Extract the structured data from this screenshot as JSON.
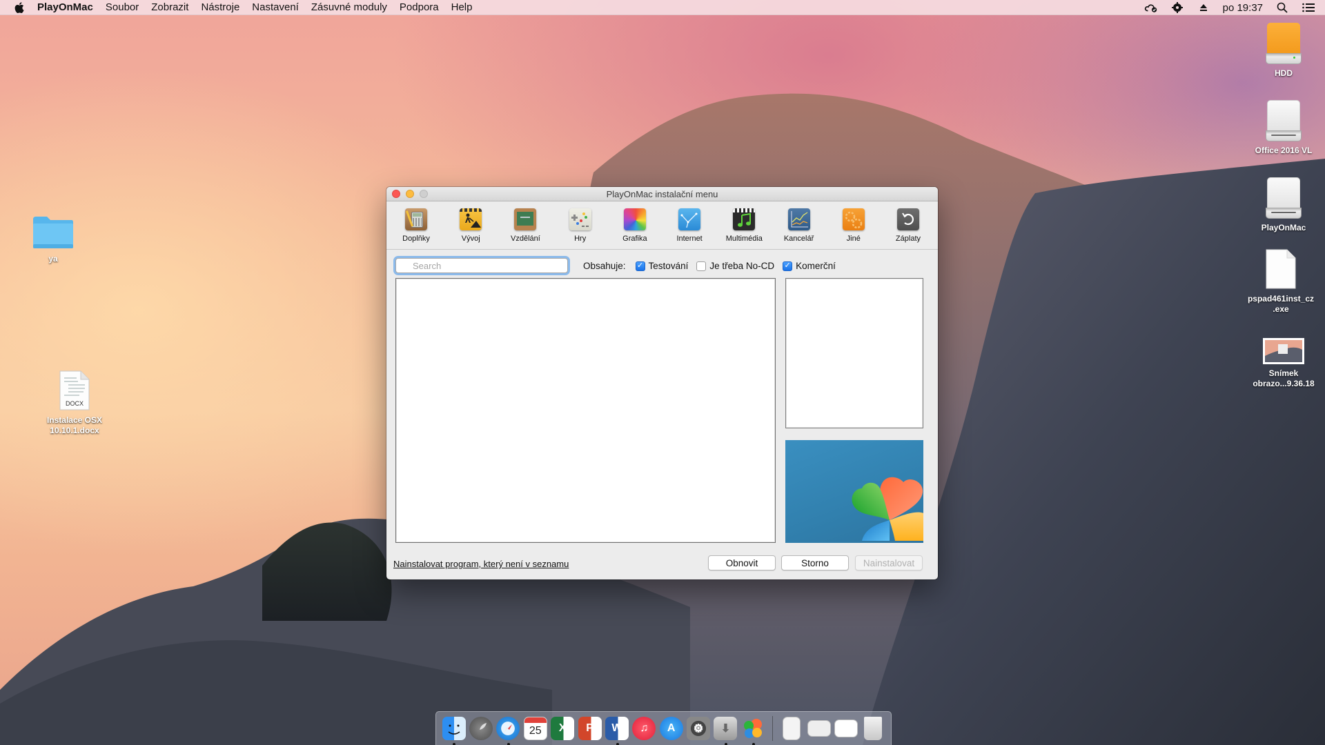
{
  "menubar": {
    "app_name": "PlayOnMac",
    "items": [
      "Soubor",
      "Zobrazit",
      "Nástroje",
      "Nastavení",
      "Zásuvné moduly",
      "Podpora",
      "Help"
    ],
    "clock": "po 19:37",
    "status_icons": [
      "creative-cloud-icon",
      "gear-icon",
      "eject-icon",
      "spotlight-search-icon",
      "notification-center-icon"
    ]
  },
  "desktop": {
    "left_icons": [
      {
        "label": "ya",
        "type": "folder"
      },
      {
        "label": "Instalace OSX 10.10.1.docx",
        "type": "document",
        "badge": "DOCX"
      }
    ],
    "right_icons": [
      {
        "label": "HDD",
        "type": "drive"
      },
      {
        "label": "Office 2016 VL",
        "type": "drive"
      },
      {
        "label": "PlayOnMac",
        "type": "drive"
      },
      {
        "label": "pspad461inst_cz .exe",
        "type": "file"
      },
      {
        "label": "Snímek obrazo...9.36.18",
        "type": "screenshot"
      }
    ]
  },
  "window": {
    "title": "PlayOnMac instalační menu",
    "categories": [
      {
        "label": "Doplňky",
        "icon": "accessories-icon"
      },
      {
        "label": "Vývoj",
        "icon": "development-icon"
      },
      {
        "label": "Vzdělání",
        "icon": "education-icon"
      },
      {
        "label": "Hry",
        "icon": "games-icon"
      },
      {
        "label": "Grafika",
        "icon": "graphics-icon"
      },
      {
        "label": "Internet",
        "icon": "internet-icon"
      },
      {
        "label": "Multimédia",
        "icon": "multimedia-icon"
      },
      {
        "label": "Kancelář",
        "icon": "office-icon"
      },
      {
        "label": "Jiné",
        "icon": "other-icon"
      },
      {
        "label": "Záplaty",
        "icon": "patches-icon"
      }
    ],
    "search": {
      "placeholder": "Search",
      "value": ""
    },
    "filter_label": "Obsahuje:",
    "filters": [
      {
        "label": "Testování",
        "checked": true
      },
      {
        "label": "Je třeba No-CD",
        "checked": false
      },
      {
        "label": "Komerční",
        "checked": true
      }
    ],
    "install_unlisted_link": "Nainstalovat program, který není v seznamu",
    "buttons": {
      "refresh": "Obnovit",
      "cancel": "Storno",
      "install": "Nainstalovat"
    }
  },
  "dock": {
    "apps": [
      {
        "name": "Finder",
        "running": true
      },
      {
        "name": "Launchpad",
        "running": false
      },
      {
        "name": "Safari",
        "running": true
      },
      {
        "name": "Calendar",
        "running": false,
        "date": "25"
      },
      {
        "name": "Excel",
        "running": false
      },
      {
        "name": "PowerPoint",
        "running": false
      },
      {
        "name": "Word",
        "running": true
      },
      {
        "name": "iTunes",
        "running": false
      },
      {
        "name": "App Store",
        "running": false
      },
      {
        "name": "System Preferences",
        "running": false
      },
      {
        "name": "Installer",
        "running": true
      },
      {
        "name": "PlayOnMac",
        "running": true
      }
    ],
    "stacks": [
      "Documents",
      "Downloads",
      "Recent",
      "Trash"
    ]
  }
}
